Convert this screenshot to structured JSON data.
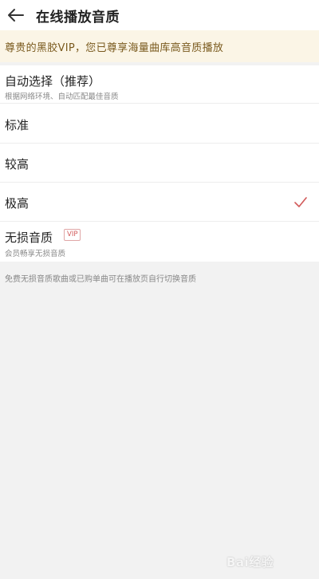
{
  "header": {
    "title": "在线播放音质",
    "back_icon": "back-arrow-icon"
  },
  "vip_banner": {
    "text": "尊贵的黑胶VIP，您已尊享海量曲库高音质播放"
  },
  "options": [
    {
      "label": "自动选择（推荐）",
      "subtitle": "根据网络环境、自动匹配最佳音质",
      "selected": false
    },
    {
      "label": "标准",
      "selected": false
    },
    {
      "label": "较高",
      "selected": false
    },
    {
      "label": "极高",
      "selected": true
    },
    {
      "label": "无损音质",
      "tag": "VIP",
      "subtitle": "会员畅享无损音质",
      "selected": false
    }
  ],
  "footnote": "免费无损音质歌曲或已购单曲可在播放页自行切换音质",
  "watermark": "Bai经验",
  "colors": {
    "accent": "#d25a5a",
    "banner_bg": "#fbf5e6",
    "banner_text": "#7a5a1e",
    "page_bg": "#f2f2f2"
  }
}
